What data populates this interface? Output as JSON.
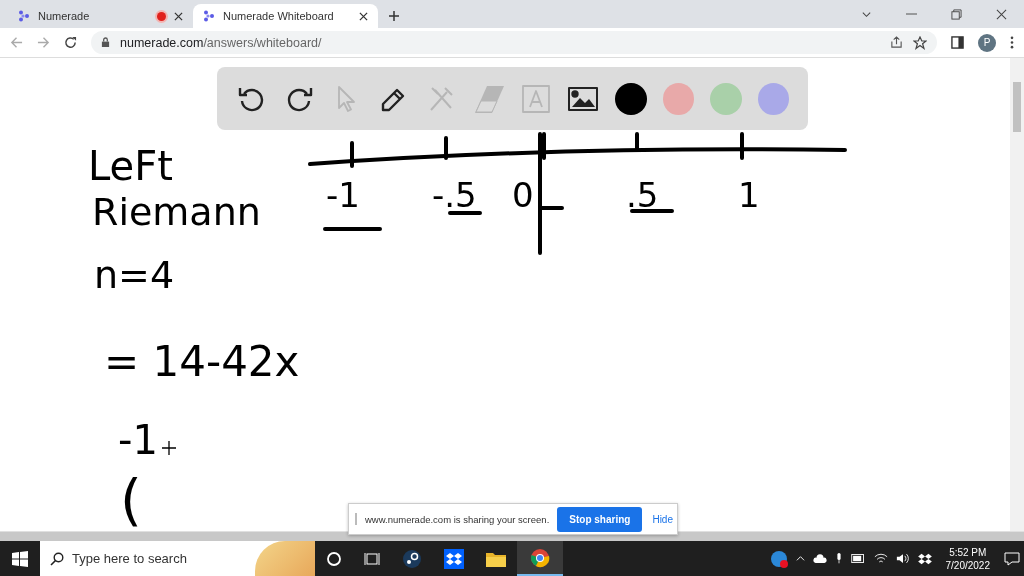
{
  "browser": {
    "tabs": [
      {
        "title": "Numerade",
        "selected": false,
        "recording": true
      },
      {
        "title": "Numerade Whiteboard",
        "selected": true,
        "recording": false
      }
    ],
    "url_host": "numerade.com",
    "url_path": "/answers/whiteboard/",
    "profile": "P"
  },
  "toolbar": {
    "tools": [
      {
        "kind": "undo",
        "disabled": false
      },
      {
        "kind": "redo",
        "disabled": false
      },
      {
        "kind": "pointer",
        "disabled": true
      },
      {
        "kind": "pencil",
        "disabled": false
      },
      {
        "kind": "tools",
        "disabled": true
      },
      {
        "kind": "eraser",
        "disabled": true
      },
      {
        "kind": "text",
        "disabled": true
      },
      {
        "kind": "image",
        "disabled": false
      }
    ],
    "colors": [
      {
        "color": "#000000"
      },
      {
        "color": "#e8a9a9"
      },
      {
        "color": "#a9d0a9"
      },
      {
        "color": "#a9a9e8"
      }
    ]
  },
  "whiteboard": {
    "notes": [
      "LeFt",
      "Riemann",
      "n=4",
      "= 14-42x",
      "-1",
      "("
    ],
    "number_line_labels": [
      "-1",
      "-.5",
      "0",
      ".5",
      "1"
    ]
  },
  "share_bar": {
    "message": "www.numerade.com is sharing your screen.",
    "stop_button": "Stop sharing",
    "hide_link": "Hide"
  },
  "taskbar": {
    "search_placeholder": "Type here to search",
    "time": "5:52 PM",
    "date": "7/20/2022"
  }
}
